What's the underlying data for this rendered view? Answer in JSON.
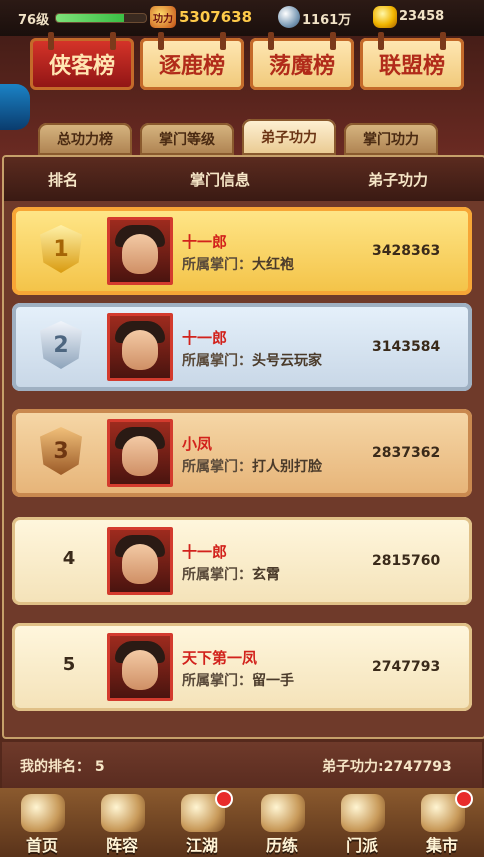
{
  "status": {
    "level": "76级",
    "power_icon_text": "功力",
    "power": "5307638",
    "silver": "1161万",
    "gold": "23458",
    "exp_fraction": 0.75,
    "icons": {
      "power": "power-badge-icon",
      "silver": "silver-ingot-icon",
      "gold": "gold-ingot-icon"
    }
  },
  "banner_tabs": [
    {
      "label": "侠客榜",
      "active": true
    },
    {
      "label": "逐鹿榜",
      "active": false
    },
    {
      "label": "荡魔榜",
      "active": false
    },
    {
      "label": "联盟榜",
      "active": false
    }
  ],
  "sub_tabs": [
    {
      "label": "总功力榜",
      "active": false
    },
    {
      "label": "掌门等级",
      "active": false
    },
    {
      "label": "弟子功力",
      "active": true
    },
    {
      "label": "掌门功力",
      "active": false
    }
  ],
  "table": {
    "headers": {
      "rank": "排名",
      "info": "掌门信息",
      "power": "弟子功力"
    },
    "rows": [
      {
        "rank": "1",
        "name": "十一郎",
        "sect_label": "所属掌门：",
        "sect": "大红袍",
        "score": "3428363"
      },
      {
        "rank": "2",
        "name": "十一郎",
        "sect_label": "所属掌门：",
        "sect": "头号云玩家",
        "score": "3143584"
      },
      {
        "rank": "3",
        "name": "小凤",
        "sect_label": "所属掌门：",
        "sect": "打人别打脸",
        "score": "2837362"
      },
      {
        "rank": "4",
        "name": "十一郎",
        "sect_label": "所属掌门：",
        "sect": "玄霄",
        "score": "2815760"
      },
      {
        "rank": "5",
        "name": "天下第一凤",
        "sect_label": "所属掌门：",
        "sect": "留一手",
        "score": "2747793"
      }
    ]
  },
  "my": {
    "rank_text": "我的排名：  5",
    "power_text": "弟子功力:2747793"
  },
  "nav": [
    {
      "label": "首页",
      "dot": false
    },
    {
      "label": "阵容",
      "dot": false
    },
    {
      "label": "江湖",
      "dot": true
    },
    {
      "label": "历练",
      "dot": false
    },
    {
      "label": "门派",
      "dot": false
    },
    {
      "label": "集市",
      "dot": true
    }
  ],
  "colors": {
    "accent_red": "#d2221c",
    "gold": "#ffcb4a"
  }
}
